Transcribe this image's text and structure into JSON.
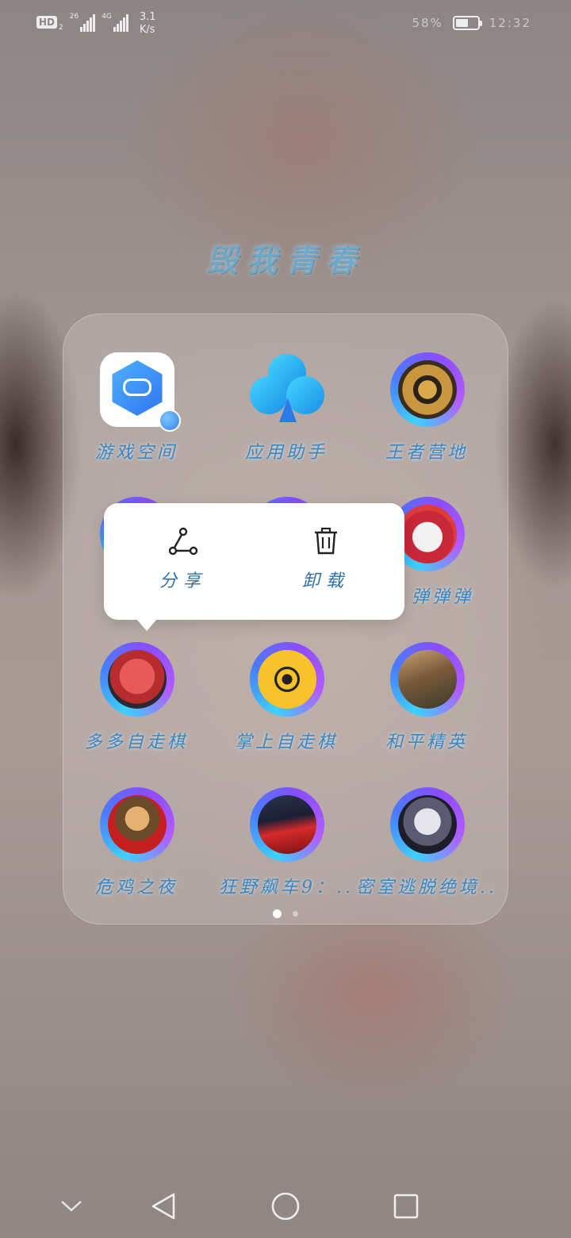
{
  "status_bar": {
    "hd": "HD",
    "hd_sub": "2",
    "sim1": "26",
    "sim2": "4G",
    "speed_value": "3.1",
    "speed_unit": "K/s",
    "battery_text": "58%",
    "battery_level": 0.58,
    "time": "12:32"
  },
  "folder": {
    "title": "毁我青春",
    "apps": [
      {
        "label": "游戏空间",
        "icon": "game-space-icon"
      },
      {
        "label": "应用助手",
        "icon": "club-icon"
      },
      {
        "label": "王者营地",
        "icon": "wangzhe-camp-icon"
      },
      {
        "label": "",
        "icon": "app-icon-hidden-1"
      },
      {
        "label": "",
        "icon": "app-icon-hidden-2"
      },
      {
        "label": "弹弹弹",
        "icon": "dice-game-icon"
      },
      {
        "label": "多多自走棋",
        "icon": "duoduo-chess-icon"
      },
      {
        "label": "掌上自走棋",
        "icon": "chess-app-icon"
      },
      {
        "label": "和平精英",
        "icon": "peace-elite-icon"
      },
      {
        "label": "危鸡之夜",
        "icon": "chicken-night-icon"
      },
      {
        "label": "狂野飙车9：..",
        "icon": "asphalt9-icon"
      },
      {
        "label": "密室逃脱绝境..",
        "icon": "escape-room-icon"
      }
    ],
    "page_count": 2,
    "active_page": 1
  },
  "popup": {
    "share_label": "分享",
    "uninstall_label": "卸载"
  },
  "nav": {
    "items": [
      "chevron-down-icon",
      "back-icon",
      "home-icon",
      "recents-icon"
    ]
  }
}
